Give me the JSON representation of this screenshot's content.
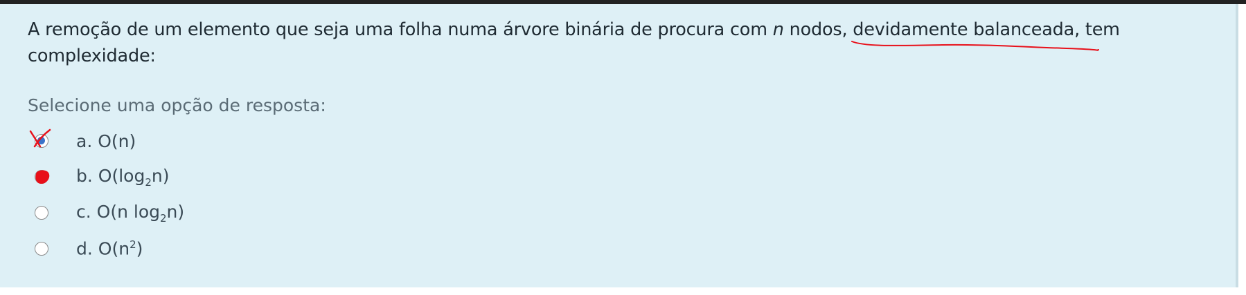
{
  "question": {
    "text_part1": "A remoção de um elemento que seja uma folha numa árvore binária de procura com ",
    "var_n": "n",
    "text_part2": " nodos, ",
    "underlined": "devidamente balanceada",
    "text_part3": ", tem complexidade:"
  },
  "prompt": "Selecione uma opção de resposta:",
  "options": [
    {
      "letter": "a.",
      "main": "O(n)",
      "selected": true
    },
    {
      "letter": "b.",
      "pre": "O(log",
      "sub": "2",
      "post": "n)",
      "selected": false
    },
    {
      "letter": "c.",
      "pre": "O(n log",
      "sub": "2",
      "post": "n)",
      "selected": false
    },
    {
      "letter": "d.",
      "pre": "O(n",
      "sup": "2",
      "post": ")",
      "selected": false
    }
  ],
  "colors": {
    "background": "#def0f6",
    "text": "#1f2b33",
    "muted_text": "#5a6b75",
    "radio_selected": "#3b73c9",
    "annotation_red": "#e8101a"
  },
  "icons": {
    "cross_mark": "x-mark-icon",
    "filled_dot": "red-dot-icon"
  }
}
